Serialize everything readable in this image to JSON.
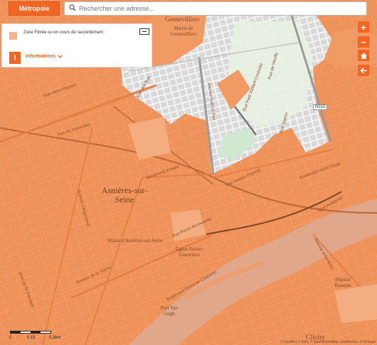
{
  "topbar": {
    "metro_label": "Métropole",
    "search_placeholder": "Rechercher une adresse..."
  },
  "legend": {
    "zone_label": "Zone Fibrée ou en cours de raccordement",
    "info_badge": "!",
    "info_label": "Informations"
  },
  "controls": {
    "zoom_in": "+",
    "zoom_out": "−"
  },
  "scale": {
    "labels": [
      "0",
      "0.15",
      "0.3km"
    ]
  },
  "map": {
    "city": "Asnières-sur-Seine",
    "labels": {
      "gennevilliers": "Gennevilliers",
      "mairie_gennevilliers": "Mairie de Gennevilliers",
      "mairie_asnieres": "Mairie d'Asnières-sur-Seine",
      "eglise": "Église Sainte-Geneviève",
      "port_van_gogh": "Port Van Gogh",
      "hopital": "Hôpital Beaujon",
      "clichy": "Clichy",
      "n315": "N315"
    },
    "streets": [
      "Rue Henri Dupont",
      "Rue de Colombes",
      "Boulevard Voltaire",
      "Avenue d'Argenteuil",
      "Rue Pierre Brossolette",
      "Avenue de la Marne",
      "Quai du Dr Dervaux",
      "Boulevard Pierre de Coubertin",
      "Rue des Bas",
      "Avenue Gabriel Péri",
      "Rue Paul Vaillant-Couturier",
      "Avenue d'Asnières",
      "Quai Aulagnier",
      "Boulevard Victor Hugo",
      "Rue Martre",
      "Rue de Neuilly",
      "Rue Gaston Paymal"
    ],
    "attribution": "© Leaflet | © IGN, © OpenStreetMap contributors, © Orange"
  }
}
